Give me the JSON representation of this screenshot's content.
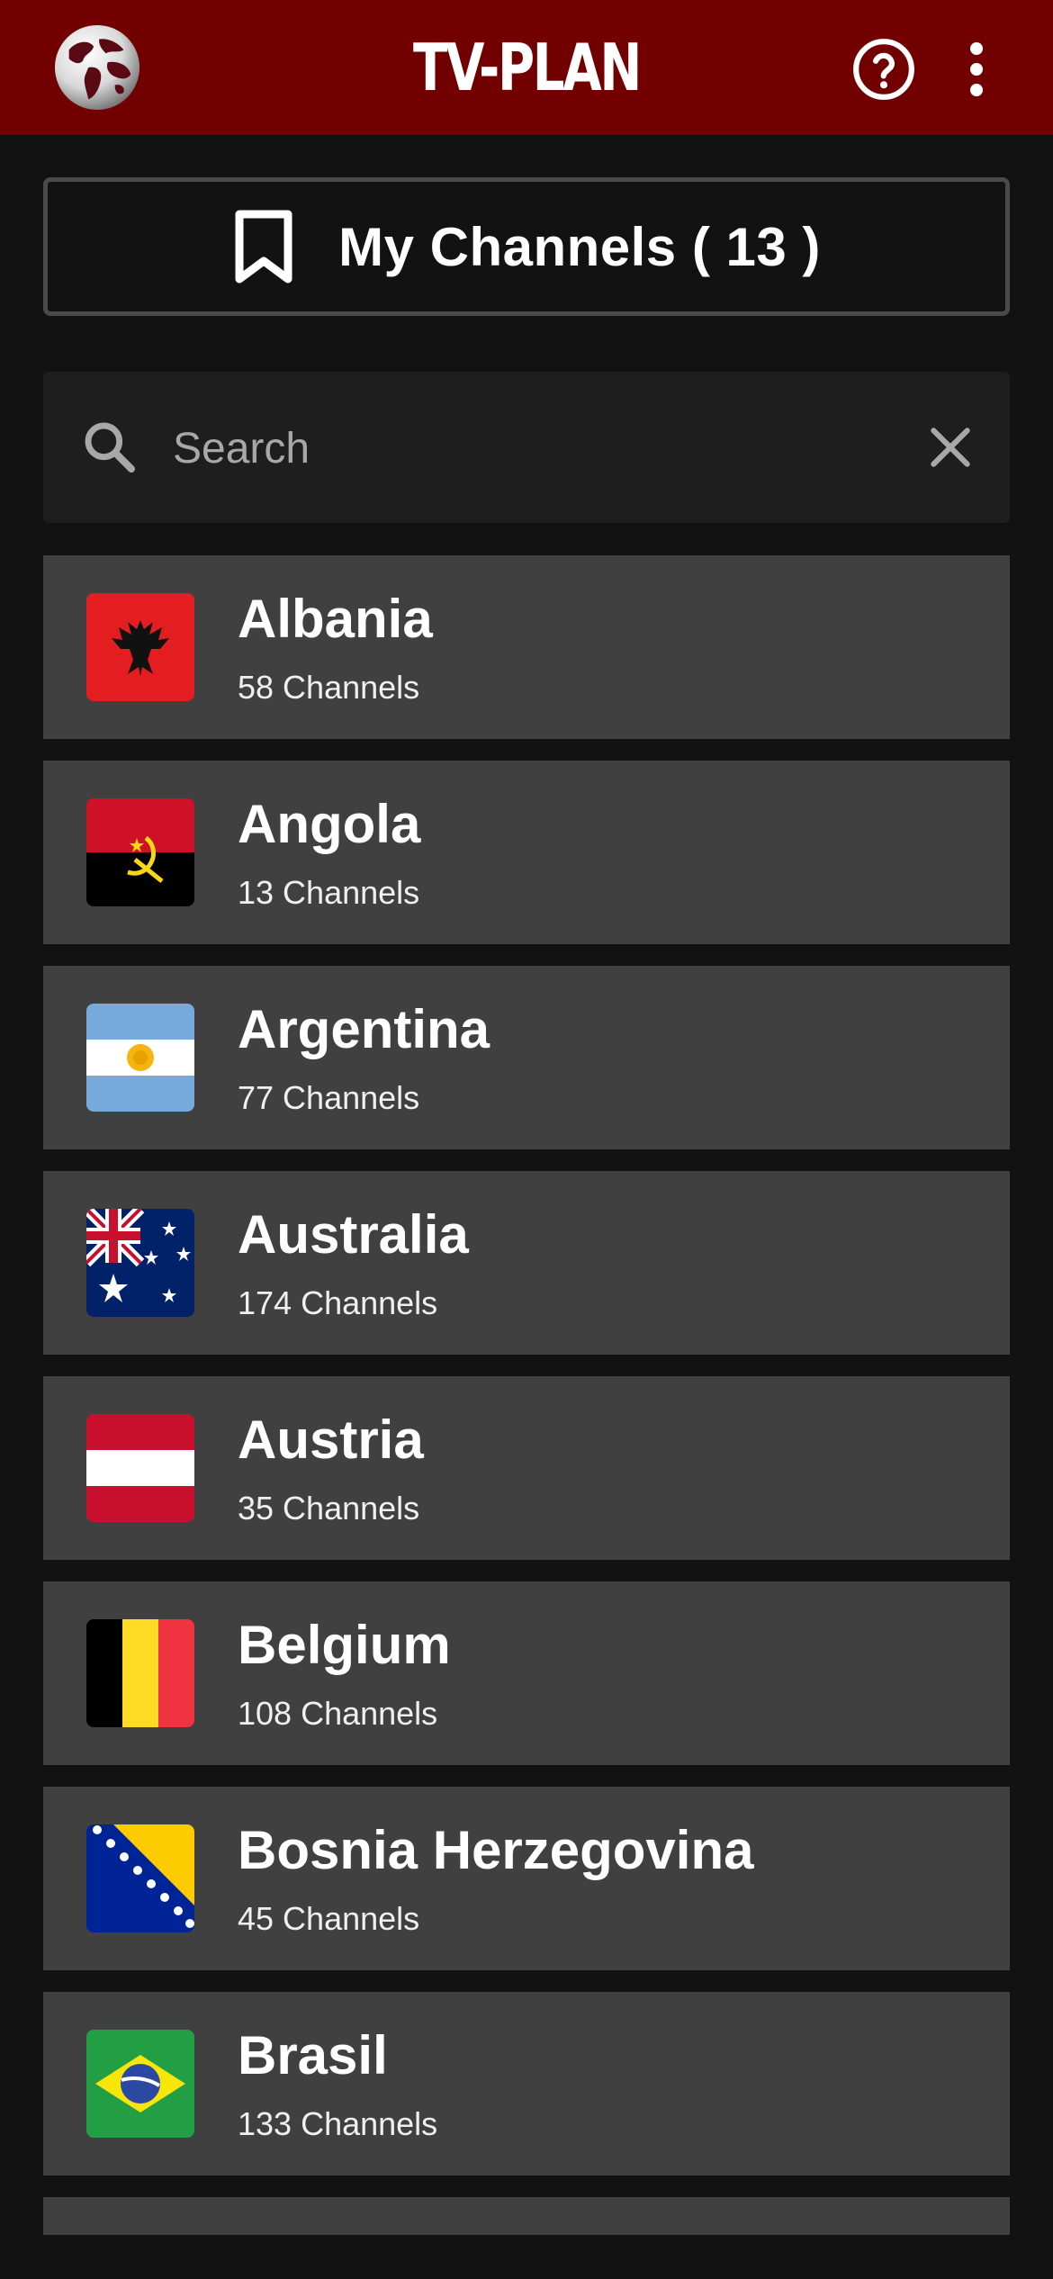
{
  "app": {
    "title": "TV-PLAN"
  },
  "icons": {
    "logo": "globe-logo-icon",
    "help": "help-circle-icon",
    "more": "more-vert-icon",
    "bookmark": "bookmark-icon",
    "search": "search-icon",
    "clear": "close-icon"
  },
  "colors": {
    "appbar": "#730000",
    "background": "#121212",
    "row": "#404040",
    "search_bg": "#1e1e1e"
  },
  "my_channels": {
    "label": "My Channels ( 13 )"
  },
  "search": {
    "placeholder": "Search",
    "value": ""
  },
  "countries": [
    {
      "name": "Albania",
      "count": "58 Channels",
      "flag": "albania"
    },
    {
      "name": "Angola",
      "count": "13 Channels",
      "flag": "angola"
    },
    {
      "name": "Argentina",
      "count": "77 Channels",
      "flag": "argentina"
    },
    {
      "name": "Australia",
      "count": "174 Channels",
      "flag": "australia"
    },
    {
      "name": "Austria",
      "count": "35 Channels",
      "flag": "austria"
    },
    {
      "name": "Belgium",
      "count": "108 Channels",
      "flag": "belgium"
    },
    {
      "name": "Bosnia Herzegovina",
      "count": "45 Channels",
      "flag": "bosnia"
    },
    {
      "name": "Brasil",
      "count": "133 Channels",
      "flag": "brasil"
    }
  ]
}
